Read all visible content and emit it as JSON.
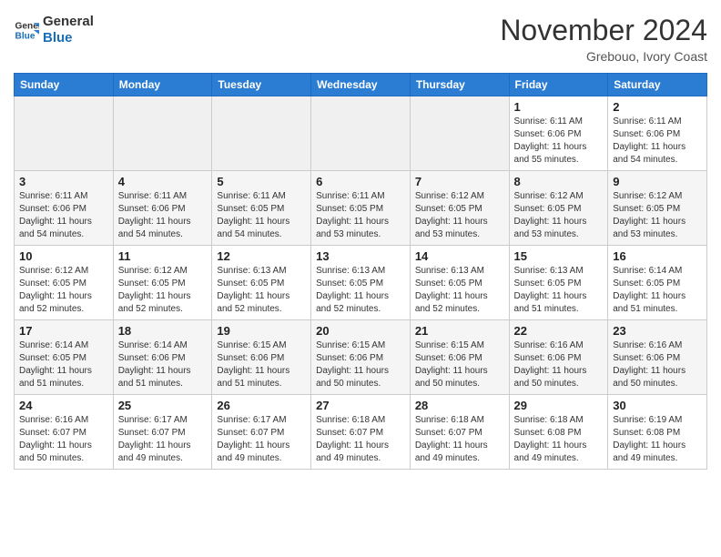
{
  "logo": {
    "line1": "General",
    "line2": "Blue"
  },
  "title": "November 2024",
  "location": "Grebouo, Ivory Coast",
  "days_header": [
    "Sunday",
    "Monday",
    "Tuesday",
    "Wednesday",
    "Thursday",
    "Friday",
    "Saturday"
  ],
  "weeks": [
    [
      {
        "day": "",
        "info": ""
      },
      {
        "day": "",
        "info": ""
      },
      {
        "day": "",
        "info": ""
      },
      {
        "day": "",
        "info": ""
      },
      {
        "day": "",
        "info": ""
      },
      {
        "day": "1",
        "info": "Sunrise: 6:11 AM\nSunset: 6:06 PM\nDaylight: 11 hours\nand 55 minutes."
      },
      {
        "day": "2",
        "info": "Sunrise: 6:11 AM\nSunset: 6:06 PM\nDaylight: 11 hours\nand 54 minutes."
      }
    ],
    [
      {
        "day": "3",
        "info": "Sunrise: 6:11 AM\nSunset: 6:06 PM\nDaylight: 11 hours\nand 54 minutes."
      },
      {
        "day": "4",
        "info": "Sunrise: 6:11 AM\nSunset: 6:06 PM\nDaylight: 11 hours\nand 54 minutes."
      },
      {
        "day": "5",
        "info": "Sunrise: 6:11 AM\nSunset: 6:05 PM\nDaylight: 11 hours\nand 54 minutes."
      },
      {
        "day": "6",
        "info": "Sunrise: 6:11 AM\nSunset: 6:05 PM\nDaylight: 11 hours\nand 53 minutes."
      },
      {
        "day": "7",
        "info": "Sunrise: 6:12 AM\nSunset: 6:05 PM\nDaylight: 11 hours\nand 53 minutes."
      },
      {
        "day": "8",
        "info": "Sunrise: 6:12 AM\nSunset: 6:05 PM\nDaylight: 11 hours\nand 53 minutes."
      },
      {
        "day": "9",
        "info": "Sunrise: 6:12 AM\nSunset: 6:05 PM\nDaylight: 11 hours\nand 53 minutes."
      }
    ],
    [
      {
        "day": "10",
        "info": "Sunrise: 6:12 AM\nSunset: 6:05 PM\nDaylight: 11 hours\nand 52 minutes."
      },
      {
        "day": "11",
        "info": "Sunrise: 6:12 AM\nSunset: 6:05 PM\nDaylight: 11 hours\nand 52 minutes."
      },
      {
        "day": "12",
        "info": "Sunrise: 6:13 AM\nSunset: 6:05 PM\nDaylight: 11 hours\nand 52 minutes."
      },
      {
        "day": "13",
        "info": "Sunrise: 6:13 AM\nSunset: 6:05 PM\nDaylight: 11 hours\nand 52 minutes."
      },
      {
        "day": "14",
        "info": "Sunrise: 6:13 AM\nSunset: 6:05 PM\nDaylight: 11 hours\nand 52 minutes."
      },
      {
        "day": "15",
        "info": "Sunrise: 6:13 AM\nSunset: 6:05 PM\nDaylight: 11 hours\nand 51 minutes."
      },
      {
        "day": "16",
        "info": "Sunrise: 6:14 AM\nSunset: 6:05 PM\nDaylight: 11 hours\nand 51 minutes."
      }
    ],
    [
      {
        "day": "17",
        "info": "Sunrise: 6:14 AM\nSunset: 6:05 PM\nDaylight: 11 hours\nand 51 minutes."
      },
      {
        "day": "18",
        "info": "Sunrise: 6:14 AM\nSunset: 6:06 PM\nDaylight: 11 hours\nand 51 minutes."
      },
      {
        "day": "19",
        "info": "Sunrise: 6:15 AM\nSunset: 6:06 PM\nDaylight: 11 hours\nand 51 minutes."
      },
      {
        "day": "20",
        "info": "Sunrise: 6:15 AM\nSunset: 6:06 PM\nDaylight: 11 hours\nand 50 minutes."
      },
      {
        "day": "21",
        "info": "Sunrise: 6:15 AM\nSunset: 6:06 PM\nDaylight: 11 hours\nand 50 minutes."
      },
      {
        "day": "22",
        "info": "Sunrise: 6:16 AM\nSunset: 6:06 PM\nDaylight: 11 hours\nand 50 minutes."
      },
      {
        "day": "23",
        "info": "Sunrise: 6:16 AM\nSunset: 6:06 PM\nDaylight: 11 hours\nand 50 minutes."
      }
    ],
    [
      {
        "day": "24",
        "info": "Sunrise: 6:16 AM\nSunset: 6:07 PM\nDaylight: 11 hours\nand 50 minutes."
      },
      {
        "day": "25",
        "info": "Sunrise: 6:17 AM\nSunset: 6:07 PM\nDaylight: 11 hours\nand 49 minutes."
      },
      {
        "day": "26",
        "info": "Sunrise: 6:17 AM\nSunset: 6:07 PM\nDaylight: 11 hours\nand 49 minutes."
      },
      {
        "day": "27",
        "info": "Sunrise: 6:18 AM\nSunset: 6:07 PM\nDaylight: 11 hours\nand 49 minutes."
      },
      {
        "day": "28",
        "info": "Sunrise: 6:18 AM\nSunset: 6:07 PM\nDaylight: 11 hours\nand 49 minutes."
      },
      {
        "day": "29",
        "info": "Sunrise: 6:18 AM\nSunset: 6:08 PM\nDaylight: 11 hours\nand 49 minutes."
      },
      {
        "day": "30",
        "info": "Sunrise: 6:19 AM\nSunset: 6:08 PM\nDaylight: 11 hours\nand 49 minutes."
      }
    ]
  ]
}
